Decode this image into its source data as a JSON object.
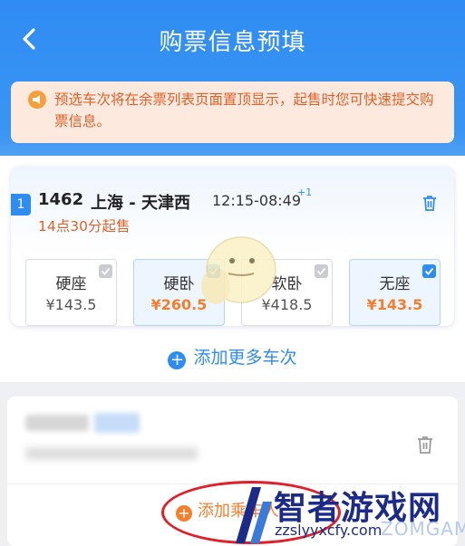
{
  "header": {
    "title": "购票信息预填"
  },
  "notice": {
    "text": "预选车次将在余票列表页面置顶显示，起售时您可快速提交购票信息。"
  },
  "train": {
    "tag": "1",
    "number": "1462",
    "route": "上海 - 天津西",
    "time": "12:15-08:49",
    "day_offset": "+1",
    "sale_info": "14点30分起售",
    "seats": [
      {
        "name": "硬座",
        "price": "¥143.5",
        "selected": false
      },
      {
        "name": "硬卧",
        "price": "¥260.5",
        "selected": true
      },
      {
        "name": "软卧",
        "price": "¥418.5",
        "selected": false
      },
      {
        "name": "无座",
        "price": "¥143.5",
        "selected": true
      }
    ]
  },
  "actions": {
    "add_train": "添加更多车次",
    "add_passenger": "添加乘车人"
  },
  "watermark": {
    "title": "智者游戏网",
    "url": "zzslyyxcfy.com",
    "game": "ZOMGAME"
  },
  "colors": {
    "primary": "#2f8cf3",
    "accent": "#f47f2c",
    "notice_text": "#e0622a"
  }
}
